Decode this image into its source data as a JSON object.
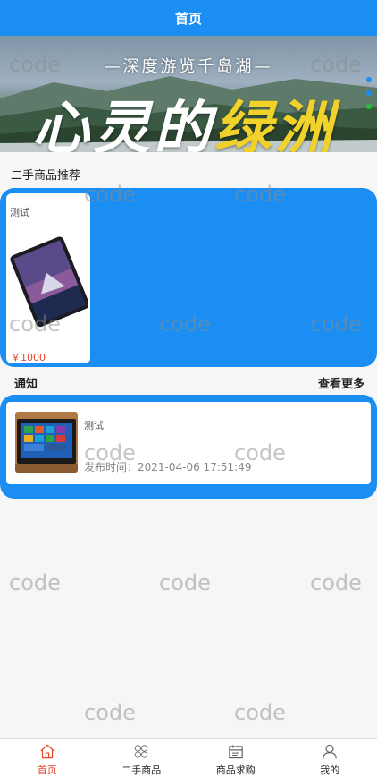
{
  "header": {
    "title": "首页"
  },
  "banner": {
    "subtitle": "—深度游览千岛湖—",
    "headline_part1": "心灵的",
    "headline_part2": "绿洲",
    "indicator_count": 3,
    "active_indicator": 3
  },
  "products_section": {
    "title": "二手商品推荐",
    "items": [
      {
        "name": "测试",
        "price": "￥1000",
        "image_icon": "tablet-photo"
      }
    ]
  },
  "notice_section": {
    "title": "通知",
    "more_label": "查看更多",
    "items": [
      {
        "name": "测试",
        "time": "发布时间：2021-04-06 17:51:49",
        "image_icon": "laptop-photo"
      }
    ]
  },
  "watermark_text": "code",
  "tabbar": {
    "items": [
      {
        "label": "首页",
        "icon": "home-icon",
        "active": true
      },
      {
        "label": "二手商品",
        "icon": "grid-icon",
        "active": false
      },
      {
        "label": "商品求购",
        "icon": "calendar-icon",
        "active": false
      },
      {
        "label": "我的",
        "icon": "user-icon",
        "active": false
      }
    ]
  },
  "colors": {
    "primary": "#1a8ef2",
    "accent": "#e8452c",
    "indicator_active": "#22c23a"
  }
}
